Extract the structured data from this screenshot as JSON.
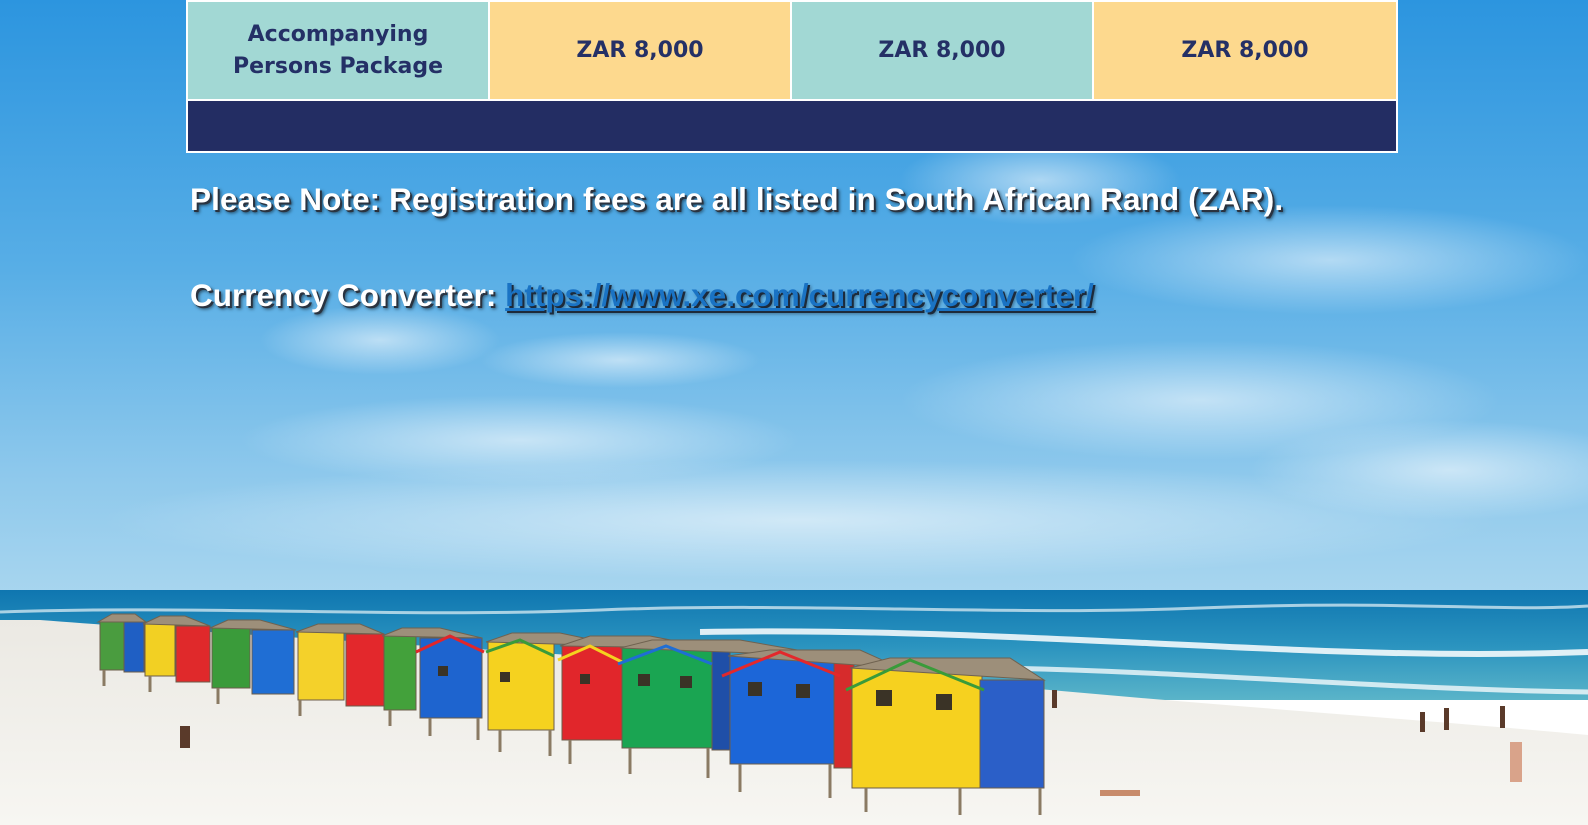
{
  "fees_table": {
    "rows": [
      {
        "label": "Accompanying Persons Package",
        "prices": [
          "ZAR 8,000",
          "ZAR 8,000",
          "ZAR 8,000"
        ]
      }
    ]
  },
  "note": "Please Note: Registration fees are all listed in South African Rand (ZAR).",
  "currency_converter": {
    "label": "Currency Converter: ",
    "link_text": "https://www.xe.com/currencyconverter/"
  },
  "colors": {
    "table_teal": "#a2d8d4",
    "table_amber": "#fdd98e",
    "table_text": "#243066",
    "table_footer": "#232d63",
    "link": "#1a73c4",
    "sky": "#3a9fe0",
    "ocean": "#1a87b8",
    "sand": "#f3f1ec"
  },
  "background": {
    "description_icon": "beach-huts-photo"
  }
}
